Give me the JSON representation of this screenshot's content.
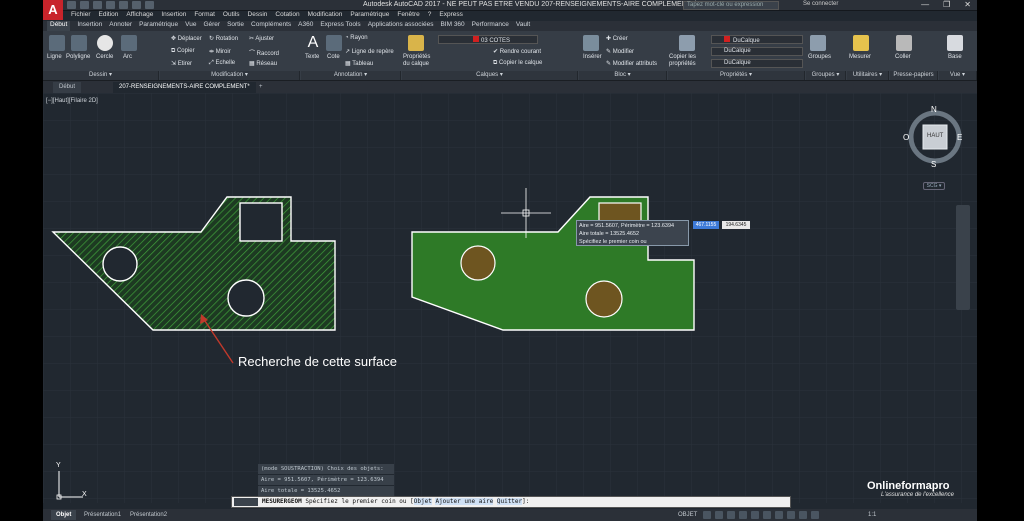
{
  "window": {
    "title": "Autodesk AutoCAD 2017 - NE PEUT PAS ETRE VENDU    207-RENSEIGNEMENTS-AIRE COMPLEMENT.dwg",
    "search_placeholder": "Tapez mot-clé ou expression",
    "connect_label": "Se connecter",
    "controls": [
      "—",
      "❐",
      "✕"
    ]
  },
  "menubar": [
    "Fichier",
    "Edition",
    "Affichage",
    "Insertion",
    "Format",
    "Outils",
    "Dessin",
    "Cotation",
    "Modification",
    "Paramétrique",
    "Fenêtre",
    "?",
    "Express"
  ],
  "ribbon_tabs": [
    "Début",
    "Insertion",
    "Annoter",
    "Paramétrique",
    "Vue",
    "Gérer",
    "Sortie",
    "Compléments",
    "A360",
    "Express Tools",
    "Applications associées",
    "BIM 360",
    "Performance",
    "Vault"
  ],
  "ribbon": {
    "dessin": {
      "title": "Dessin ▾",
      "tools": [
        "Ligne",
        "Polyligne",
        "Cercle",
        "Arc"
      ]
    },
    "modification": {
      "title": "Modification ▾",
      "tools": [
        "Déplacer",
        "Rotation",
        "Ajuster",
        "Copier",
        "Miroir",
        "Raccord",
        "Etirer",
        "Echelle",
        "Réseau"
      ]
    },
    "annotation": {
      "title": "Annotation ▾",
      "tools": [
        "Texte",
        "Cote",
        "Rayon",
        "Ligne de repère",
        "Tableau"
      ]
    },
    "calques": {
      "title": "Calques ▾",
      "tools": [
        "Propriétés du calque",
        "03 COTES",
        "Rendre courant",
        "Copier le calque"
      ]
    },
    "bloc": {
      "title": "Bloc ▾",
      "tools": [
        "Insérer",
        "Créer",
        "Modifier",
        "Modifier attributs"
      ]
    },
    "proprietes": {
      "title": "Propriétés ▾",
      "tools": [
        "Copier les propriétés",
        "DuCalque",
        "DuCalque",
        "DuCalque"
      ]
    },
    "groupes": {
      "title": "Groupes ▾",
      "tools": [
        "Groupes"
      ]
    },
    "utilitaires": {
      "title": "Utilitaires ▾",
      "tools": [
        "Mesurer"
      ]
    },
    "pressepapiers": {
      "title": "Presse-papiers",
      "tools": [
        "Coller"
      ]
    },
    "vue": {
      "title": "Vue ▾",
      "tools": [
        "Base"
      ]
    }
  },
  "doc_tabs": [
    "Début",
    "207-RENSEIGNEMENTS-AIRE COMPLEMENT*",
    "+"
  ],
  "viewport_label": "[−][Haut][Filaire 2D]",
  "viewcube": {
    "face": "HAUT",
    "n": "N",
    "s": "S",
    "e": "E",
    "o": "O",
    "wcs": "SCG ▾"
  },
  "tooltip": {
    "line1": "Aire = 951.5607, Périmètre = 123.6394",
    "line2": "Aire totale = 13525.4652",
    "line3": "Spécifiez le premier coin ou"
  },
  "dynamic_input": {
    "x": "467.1155",
    "y": "194.6345"
  },
  "annotation_text": "Recherche de cette surface",
  "command_history": [
    "(mode SOUSTRACTION) Choix des objets:",
    "Aire = 951.5607, Périmètre = 123.6394",
    "Aire totale = 13525.4652"
  ],
  "command_line": {
    "command": "MESURERGEOM",
    "prompt": "Spécifiez le premier coin ou [",
    "options": [
      "Objet",
      "Ajouter une aire",
      "Quitter"
    ],
    "suffix": "]:"
  },
  "layout_tabs": [
    "Objet",
    "Présentation1",
    "Présentation2"
  ],
  "status": {
    "mode": "OBJET",
    "scale": "1:1"
  },
  "brand": {
    "name": "Onlineformapro",
    "tagline": "L'assurance de l'excellence"
  },
  "ucs": {
    "x_label": "X",
    "y_label": "Y"
  },
  "colors": {
    "canvas": "#212830",
    "hatch_green": "#2f7d2a",
    "fill_green": "#2e7a27",
    "hole_brown": "#6e5520",
    "outline": "#ffffff"
  }
}
